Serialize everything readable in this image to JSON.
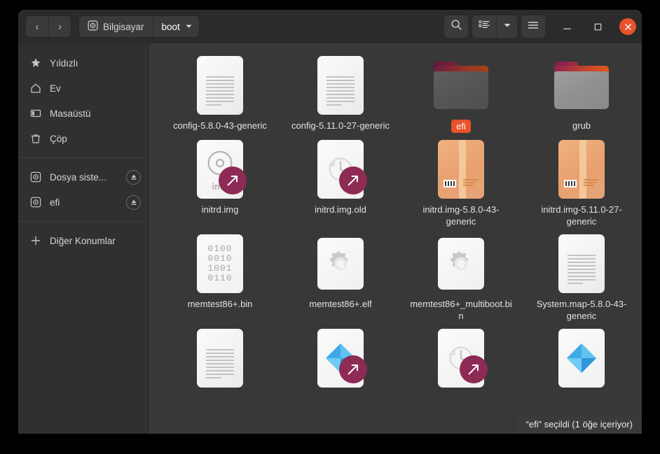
{
  "window": {
    "titlebar": {
      "back_label": "‹",
      "forward_label": "›",
      "breadcrumbs": [
        {
          "label": "Bilgisayar",
          "icon": "disk-icon"
        },
        {
          "label": "boot",
          "icon": "chevron-down-icon"
        }
      ],
      "search_icon": "search-icon",
      "view_list_icon": "list-view-icon",
      "view_dropdown_icon": "chevron-down-icon",
      "menu_icon": "hamburger-menu-icon",
      "minimize_label": "—",
      "maximize_label": "□",
      "close_label": "✕"
    }
  },
  "sidebar": {
    "items": [
      {
        "label": "Yıldızlı",
        "icon": "star-icon",
        "eject": false
      },
      {
        "label": "Ev",
        "icon": "home-icon",
        "eject": false
      },
      {
        "label": "Masaüstü",
        "icon": "desktop-icon",
        "eject": false
      },
      {
        "label": "Çöp",
        "icon": "trash-icon",
        "eject": false
      }
    ],
    "devices": [
      {
        "label": "Dosya siste...",
        "icon": "disk-icon",
        "eject": true
      },
      {
        "label": "efi",
        "icon": "disk-icon",
        "eject": true
      }
    ],
    "other": {
      "label": "Diğer Konumlar",
      "icon": "plus-icon"
    }
  },
  "files": [
    {
      "name": "config-5.8.0-43-generic",
      "icon": "text-document-icon",
      "selected": false,
      "symlink": false
    },
    {
      "name": "config-5.11.0-27-generic",
      "icon": "text-document-icon",
      "selected": false,
      "symlink": false
    },
    {
      "name": "efi",
      "icon": "folder-icon",
      "selected": true,
      "symlink": false
    },
    {
      "name": "grub",
      "icon": "folder-icon",
      "selected": false,
      "symlink": false
    },
    {
      "name": "initrd.img",
      "icon": "disc-image-icon",
      "selected": false,
      "symlink": true,
      "overlay_text": "img"
    },
    {
      "name": "initrd.img.old",
      "icon": "backup-clock-icon",
      "selected": false,
      "symlink": true
    },
    {
      "name": "initrd.img-5.8.0-43-generic",
      "icon": "archive-package-icon",
      "selected": false,
      "symlink": false
    },
    {
      "name": "initrd.img-5.11.0-27-generic",
      "icon": "archive-package-icon",
      "selected": false,
      "symlink": false
    },
    {
      "name": "memtest86+.bin",
      "icon": "binary-file-icon",
      "selected": false,
      "symlink": false,
      "binary_rows": [
        "0100",
        "0010",
        "1001",
        "0110"
      ]
    },
    {
      "name": "memtest86+.elf",
      "icon": "executable-gear-icon",
      "selected": false,
      "symlink": false
    },
    {
      "name": "memtest86+_multiboot.bin",
      "icon": "executable-gear-icon",
      "selected": false,
      "symlink": false
    },
    {
      "name": "System.map-5.8.0-43-generic",
      "icon": "text-document-icon",
      "selected": false,
      "symlink": false
    },
    {
      "name": "",
      "icon": "text-document-icon",
      "selected": false,
      "symlink": false
    },
    {
      "name": "",
      "icon": "kernel-diamond-icon",
      "selected": false,
      "symlink": true
    },
    {
      "name": "",
      "icon": "backup-clock-icon",
      "selected": false,
      "symlink": true
    },
    {
      "name": "",
      "icon": "kernel-diamond-icon",
      "selected": false,
      "symlink": false
    }
  ],
  "statusbar": {
    "text": "“efi” seçildi  (1 öğe içeriyor)"
  },
  "colors": {
    "accent": "#e9522a",
    "symlink_badge": "#8d2b55",
    "window_bg": "#383838",
    "sidebar_bg": "#303030",
    "headerbar_bg": "#2b2b2b"
  }
}
